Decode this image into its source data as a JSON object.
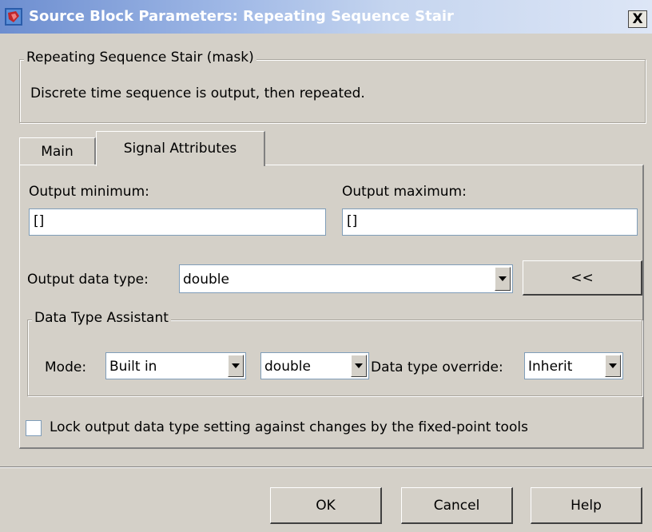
{
  "window": {
    "title": "Source Block Parameters: Repeating Sequence Stair",
    "close_label": "X"
  },
  "mask_group": {
    "legend": "Repeating Sequence Stair (mask)",
    "description": "Discrete time sequence is output, then repeated."
  },
  "tabs": [
    {
      "label": "Main",
      "selected": false
    },
    {
      "label": "Signal Attributes",
      "selected": true
    }
  ],
  "signal_attributes": {
    "output_minimum_label": "Output minimum:",
    "output_minimum_value": "[]",
    "output_maximum_label": "Output maximum:",
    "output_maximum_value": "[]",
    "output_data_type_label": "Output data type:",
    "output_data_type_value": "double",
    "toggle_assistant_label": "<<",
    "assistant": {
      "legend": "Data Type Assistant",
      "mode_label": "Mode:",
      "mode_value": "Built in",
      "builtin_type_value": "double",
      "override_label": "Data type override:",
      "override_value": "Inherit"
    },
    "lock_checkbox_label": "Lock output data type setting against changes by the fixed-point tools",
    "lock_checked": false
  },
  "buttons": {
    "ok": "OK",
    "cancel": "Cancel",
    "help": "Help"
  },
  "colors": {
    "dialog_face": "#d4d0c8",
    "titlebar_start": "#6d8ed0",
    "titlebar_end": "#dde6f6"
  }
}
